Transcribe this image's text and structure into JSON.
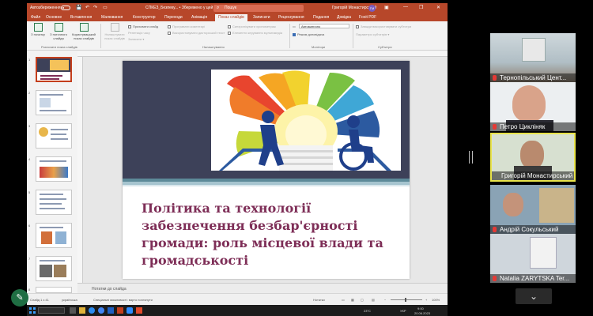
{
  "window": {
    "autosave_label": "Автозбереження",
    "doc_title": "СПКЕЗ_Безпеку... • Збережено у цей ПК",
    "search_placeholder": "Пошук",
    "user_name": "Григорій Монастирський",
    "user_initials": "ГМ"
  },
  "menu_tabs": [
    "Файл",
    "Основне",
    "Вставлення",
    "Малювання",
    "Конструктор",
    "Переходи",
    "Анімація",
    "Показ слайдів",
    "Записати",
    "Рецензування",
    "Подання",
    "Довідка",
    "Foxit PDF"
  ],
  "active_tab": "Показ слайдів",
  "ribbon": {
    "start_show": {
      "from_beginning": "З початку",
      "from_current": "З поточного слайда",
      "custom_show": "Користувацький показ слайдів",
      "group_label": "Розпочати показ слайдів"
    },
    "setup": {
      "setup_show": "Налаштувати показ слайдів",
      "hide_slide": "Приховати слайд",
      "rehearse": "Репетиція часу",
      "record": "Записати",
      "play_narrations": "Програвати коментарі",
      "use_timings": "Використовувати дикторський текст",
      "show_media": "Відобразити елементи керування",
      "keep_updated": "Синхронізувати хронометраж",
      "hide_pointer": "Елементи керування мультимедіа",
      "group_label": "Налаштування"
    },
    "monitors": {
      "monitor_value": "Автоматично",
      "presenter_view": "Режим доповідача",
      "group_label": "Монітори"
    },
    "captions": {
      "always_use": "Завжди використовувати субтитри",
      "settings": "Параметри субтитрів",
      "group_label": "Субтитри"
    }
  },
  "thumbnails": [
    "1",
    "2",
    "3",
    "4",
    "5",
    "6",
    "7",
    "8"
  ],
  "slide": {
    "title_line1": "Політика та технології",
    "title_line2": "забезпечення безбар'єрності",
    "title_line3": "громади: роль місцевої влади та",
    "title_line4": "громадськості"
  },
  "notes_placeholder": "Нотатки до слайда",
  "status": {
    "slide_counter": "Слайд 1 з 41",
    "language": "українська",
    "accessibility": "Спеціальні можливості: варто поглянути",
    "notes_btn": "Нотатки",
    "zoom": "100%"
  },
  "taskbar": {
    "weather": "23°C",
    "lang": "УКР",
    "time": "9:00",
    "date": "20.06.2023"
  },
  "participants": [
    {
      "name": "Тернопільський Цент..."
    },
    {
      "name": "Петро Цикліняк"
    },
    {
      "name": "Григорій Монастирський"
    },
    {
      "name": "Андрій Сокульський"
    },
    {
      "name": "Natalia ZARYTSKA Ter..."
    }
  ],
  "colors": {
    "ppt_accent": "#b7472a",
    "title_text": "#7e2e57",
    "slide_dark": "#3d4159",
    "active_speaker": "#e8e34a"
  }
}
